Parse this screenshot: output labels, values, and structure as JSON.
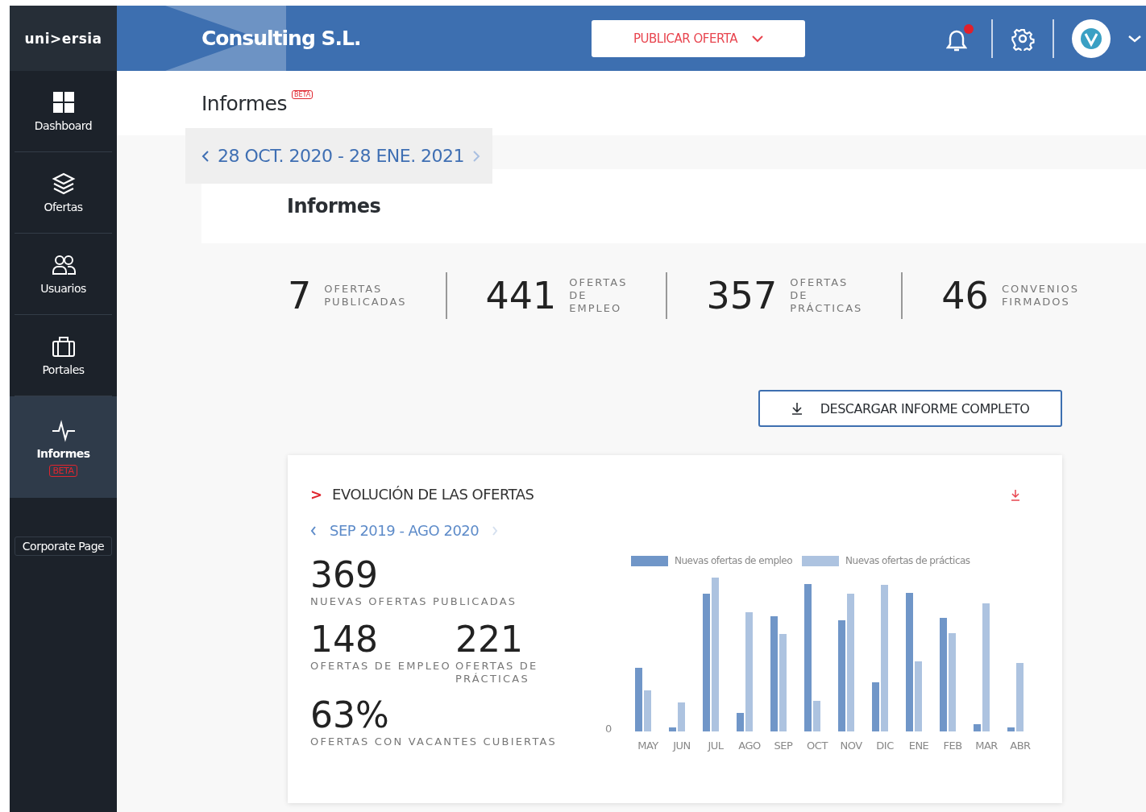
{
  "sidebar": {
    "logo": "uni>ersia",
    "items": [
      {
        "label": "Dashboard",
        "selected": false
      },
      {
        "label": "Ofertas",
        "selected": false
      },
      {
        "label": "Usuarios",
        "selected": false
      },
      {
        "label": "Portales",
        "selected": false
      },
      {
        "label": "Informes",
        "selected": true,
        "badge": "BETA"
      }
    ],
    "corporate_link": "Corporate Page"
  },
  "header": {
    "company": "Consulting S.L.",
    "publish_button": "PUBLICAR OFERTA",
    "notification_unread": true
  },
  "page": {
    "title": "Informes",
    "title_badge": "BETA",
    "date_range": "28 OCT. 2020 - 28 ENE. 2021",
    "section_title": "Informes"
  },
  "stats": [
    {
      "value": "7",
      "label": "OFERTAS PUBLICADAS"
    },
    {
      "value": "441",
      "label": "OFERTAS DE EMPLEO"
    },
    {
      "value": "357",
      "label": "OFERTAS DE PRÁCTICAS"
    },
    {
      "value": "46",
      "label": "CONVENIOS FIRMADOS"
    }
  ],
  "download_button": "DESCARGAR INFORME COMPLETO",
  "evolution_card": {
    "marker": ">",
    "title": "EVOLUCIÓN DE LAS OFERTAS",
    "date_range": "SEP 2019 - AGO 2020",
    "total": {
      "value": "369",
      "label": "NUEVAS OFERTAS PUBLICADAS"
    },
    "split": [
      {
        "value": "148",
        "label": "OFERTAS DE EMPLEO"
      },
      {
        "value": "221",
        "label": "OFERTAS DE PRÁCTICAS"
      }
    ],
    "coverage": {
      "value": "63%",
      "label": "OFERTAS CON VACANTES CUBIERTAS"
    },
    "legend": [
      {
        "label": "Nuevas ofertas de empleo",
        "color": "#7096c8"
      },
      {
        "label": "Nuevas ofertas de prácticas",
        "color": "#adc3e0"
      }
    ],
    "zero_tick": "0",
    "months": [
      "MAY",
      "JUN",
      "JUL",
      "AGO",
      "SEP",
      "OCT",
      "NOV",
      "DIC",
      "ENE",
      "FEB",
      "MAR",
      "ABR"
    ]
  }
}
